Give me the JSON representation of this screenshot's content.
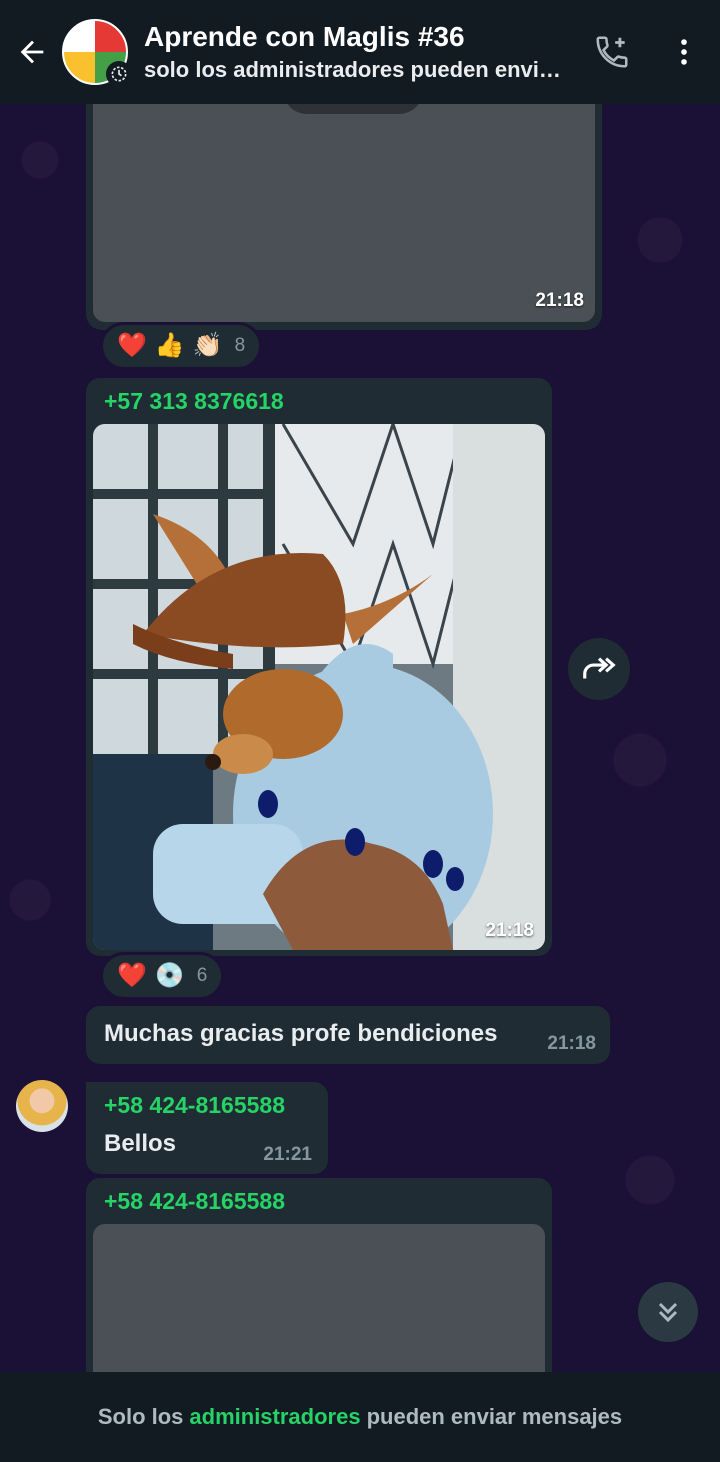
{
  "header": {
    "title": "Aprende con Maglis #36",
    "subtitle": "solo los administradores pueden envi…"
  },
  "messages": [
    {
      "type": "media",
      "time": "21:18",
      "reactions": {
        "emojis": [
          "❤️",
          "👍",
          "👏🏻"
        ],
        "count": "8"
      }
    },
    {
      "type": "media",
      "sender": "+57 313 8376618",
      "time": "21:18",
      "reactions": {
        "emojis": [
          "❤️",
          "💿"
        ],
        "count": "6"
      }
    },
    {
      "type": "text",
      "text": "Muchas gracias profe bendiciones",
      "time": "21:18"
    },
    {
      "type": "text",
      "sender": "+58 424-8165588",
      "text": "Bellos",
      "time": "21:21"
    },
    {
      "type": "media",
      "sender": "+58 424-8165588"
    }
  ],
  "footer": {
    "prefix": "Solo los",
    "link": "administradores",
    "suffix": "pueden enviar mensajes"
  },
  "colors": {
    "accent": "#25d366",
    "bubble": "#202c33",
    "header": "#121b22",
    "wallpaper": "#1b1035"
  },
  "icons": {
    "back": "arrow-left-icon",
    "call": "add-call-icon",
    "menu": "more-vertical-icon",
    "forward": "forward-icon",
    "scroll": "double-chevron-down-icon"
  }
}
